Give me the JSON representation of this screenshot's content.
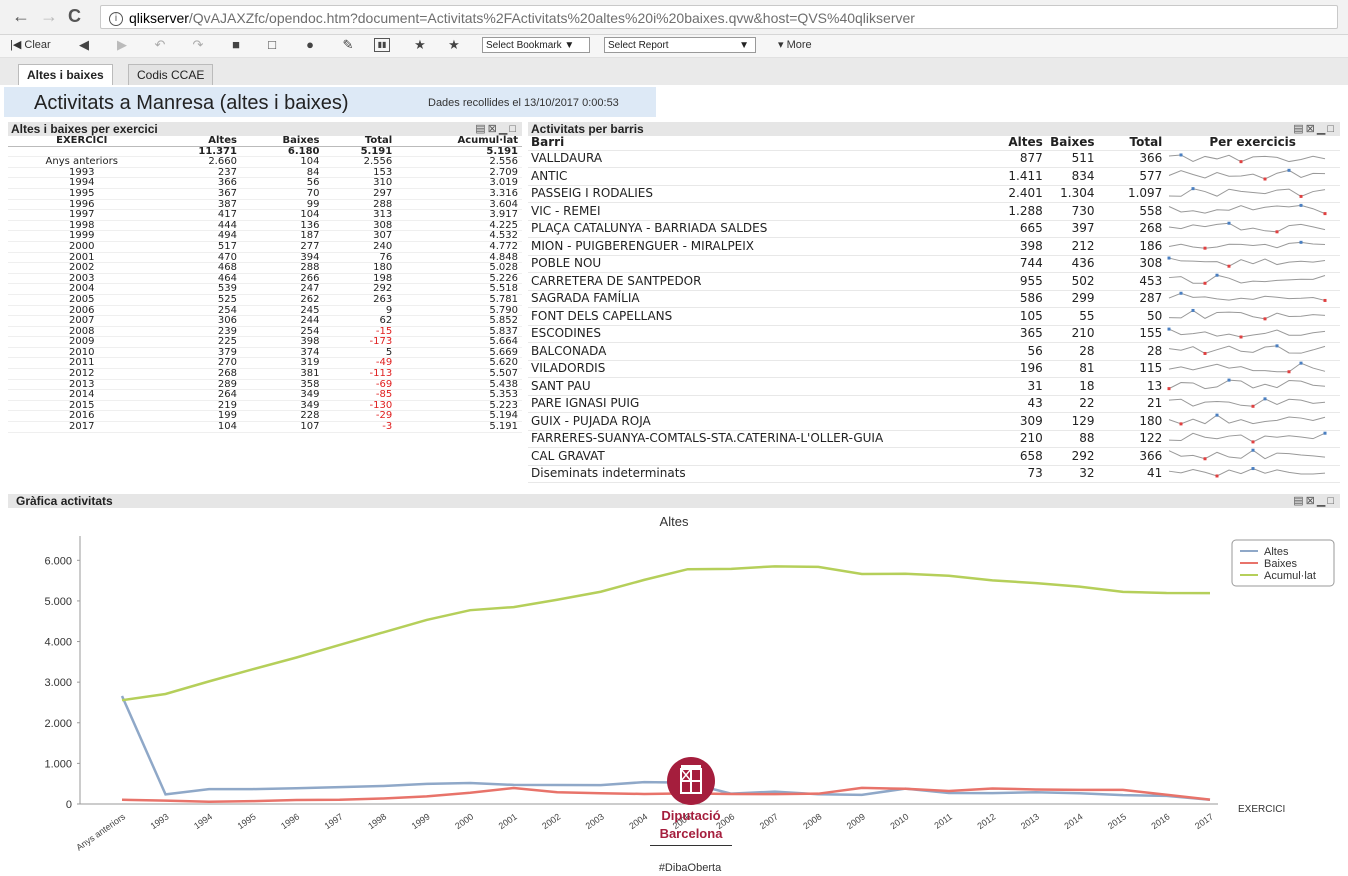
{
  "browser": {
    "url_host": "qlikserver",
    "url_path": "/QvAJAXZfc/opendoc.htm?document=Activitats%2FActivitats%20altes%20i%20baixes.qvw&host=QVS%40qlikserver",
    "back_icon": "←",
    "forward_icon": "→",
    "reload_icon": "C"
  },
  "toolbar": {
    "clear_label": "Clear",
    "bookmark_select": "Select Bookmark",
    "report_select": "Select Report",
    "more_label": "More"
  },
  "tabs": [
    {
      "label": "Altes i baixes",
      "active": true
    },
    {
      "label": "Codis CCAE",
      "active": false
    }
  ],
  "header": {
    "title": "Activitats a Manresa (altes i baixes)",
    "date": "Dades recollides el 13/10/2017 0:00:53"
  },
  "table1": {
    "caption": "Altes i baixes per exercici",
    "columns": [
      "EXERCICI",
      "Altes",
      "Baixes",
      "Total",
      "Acumul·lat"
    ],
    "totals": [
      "",
      "11.371",
      "6.180",
      "5.191",
      "5.191"
    ],
    "rows": [
      [
        "Anys anteriors",
        "2.660",
        "104",
        "2.556",
        "2.556"
      ],
      [
        "1993",
        "237",
        "84",
        "153",
        "2.709"
      ],
      [
        "1994",
        "366",
        "56",
        "310",
        "3.019"
      ],
      [
        "1995",
        "367",
        "70",
        "297",
        "3.316"
      ],
      [
        "1996",
        "387",
        "99",
        "288",
        "3.604"
      ],
      [
        "1997",
        "417",
        "104",
        "313",
        "3.917"
      ],
      [
        "1998",
        "444",
        "136",
        "308",
        "4.225"
      ],
      [
        "1999",
        "494",
        "187",
        "307",
        "4.532"
      ],
      [
        "2000",
        "517",
        "277",
        "240",
        "4.772"
      ],
      [
        "2001",
        "470",
        "394",
        "76",
        "4.848"
      ],
      [
        "2002",
        "468",
        "288",
        "180",
        "5.028"
      ],
      [
        "2003",
        "464",
        "266",
        "198",
        "5.226"
      ],
      [
        "2004",
        "539",
        "247",
        "292",
        "5.518"
      ],
      [
        "2005",
        "525",
        "262",
        "263",
        "5.781"
      ],
      [
        "2006",
        "254",
        "245",
        "9",
        "5.790"
      ],
      [
        "2007",
        "306",
        "244",
        "62",
        "5.852"
      ],
      [
        "2008",
        "239",
        "254",
        "-15",
        "5.837"
      ],
      [
        "2009",
        "225",
        "398",
        "-173",
        "5.664"
      ],
      [
        "2010",
        "379",
        "374",
        "5",
        "5.669"
      ],
      [
        "2011",
        "270",
        "319",
        "-49",
        "5.620"
      ],
      [
        "2012",
        "268",
        "381",
        "-113",
        "5.507"
      ],
      [
        "2013",
        "289",
        "358",
        "-69",
        "5.438"
      ],
      [
        "2014",
        "264",
        "349",
        "-85",
        "5.353"
      ],
      [
        "2015",
        "219",
        "349",
        "-130",
        "5.223"
      ],
      [
        "2016",
        "199",
        "228",
        "-29",
        "5.194"
      ],
      [
        "2017",
        "104",
        "107",
        "-3",
        "5.191"
      ]
    ]
  },
  "table2": {
    "caption": "Activitats per barris",
    "columns": [
      "Barri",
      "Altes",
      "Baixes",
      "Total",
      "Per exercicis"
    ],
    "rows": [
      [
        "VALLDAURA",
        "877",
        "511",
        "366"
      ],
      [
        "ANTIC",
        "1.411",
        "834",
        "577"
      ],
      [
        "PASSEIG I RODALIES",
        "2.401",
        "1.304",
        "1.097"
      ],
      [
        "VIC - REMEI",
        "1.288",
        "730",
        "558"
      ],
      [
        "PLAÇA CATALUNYA - BARRIADA SALDES",
        "665",
        "397",
        "268"
      ],
      [
        "MION - PUIGBERENGUER - MIRALPEIX",
        "398",
        "212",
        "186"
      ],
      [
        "POBLE NOU",
        "744",
        "436",
        "308"
      ],
      [
        "CARRETERA DE SANTPEDOR",
        "955",
        "502",
        "453"
      ],
      [
        "SAGRADA FAMÍLIA",
        "586",
        "299",
        "287"
      ],
      [
        "FONT DELS CAPELLANS",
        "105",
        "55",
        "50"
      ],
      [
        "ESCODINES",
        "365",
        "210",
        "155"
      ],
      [
        "BALCONADA",
        "56",
        "28",
        "28"
      ],
      [
        "VILADORDIS",
        "196",
        "81",
        "115"
      ],
      [
        "SANT PAU",
        "31",
        "18",
        "13"
      ],
      [
        "PARE IGNASI PUIG",
        "43",
        "22",
        "21"
      ],
      [
        "GUIX - PUJADA ROJA",
        "309",
        "129",
        "180"
      ],
      [
        "FARRERES-SUANYA-COMTALS-STA.CATERINA-L'OLLER-GUIA",
        "210",
        "88",
        "122"
      ],
      [
        "CAL GRAVAT",
        "658",
        "292",
        "366"
      ],
      [
        "Diseminats indeterminats",
        "73",
        "32",
        "41"
      ]
    ]
  },
  "chart_panel": {
    "caption": "Gràfica activitats"
  },
  "chart_data": {
    "type": "line",
    "title": "Altes",
    "xlabel": "EXERCICI",
    "ylabel": "",
    "ylim": [
      0,
      6500
    ],
    "yticks": [
      "0",
      "1.000",
      "2.000",
      "3.000",
      "4.000",
      "5.000",
      "6.000"
    ],
    "categories": [
      "Anys anteriors",
      "1993",
      "1994",
      "1995",
      "1996",
      "1997",
      "1998",
      "1999",
      "2000",
      "2001",
      "2002",
      "2003",
      "2004",
      "2005",
      "2006",
      "2007",
      "2008",
      "2009",
      "2010",
      "2011",
      "2012",
      "2013",
      "2014",
      "2015",
      "2016",
      "2017"
    ],
    "series": [
      {
        "name": "Altes",
        "color": "#8fa8c8",
        "values": [
          2660,
          237,
          366,
          367,
          387,
          417,
          444,
          494,
          517,
          470,
          468,
          464,
          539,
          525,
          254,
          306,
          239,
          225,
          379,
          270,
          268,
          289,
          264,
          219,
          199,
          104
        ]
      },
      {
        "name": "Baixes",
        "color": "#e8736a",
        "values": [
          104,
          84,
          56,
          70,
          99,
          104,
          136,
          187,
          277,
          394,
          288,
          266,
          247,
          262,
          245,
          244,
          254,
          398,
          374,
          319,
          381,
          358,
          349,
          349,
          228,
          107
        ]
      },
      {
        "name": "Acumul·lat",
        "color": "#b5cf5a",
        "values": [
          2556,
          2709,
          3019,
          3316,
          3604,
          3917,
          4225,
          4532,
          4772,
          4848,
          5028,
          5226,
          5518,
          5781,
          5790,
          5852,
          5837,
          5664,
          5669,
          5620,
          5507,
          5438,
          5353,
          5223,
          5194,
          5191
        ]
      }
    ],
    "legend": "top-right",
    "grid": false
  },
  "logo": {
    "line1": "Diputació",
    "line2": "Barcelona",
    "hashtag": "#DibaOberta"
  }
}
